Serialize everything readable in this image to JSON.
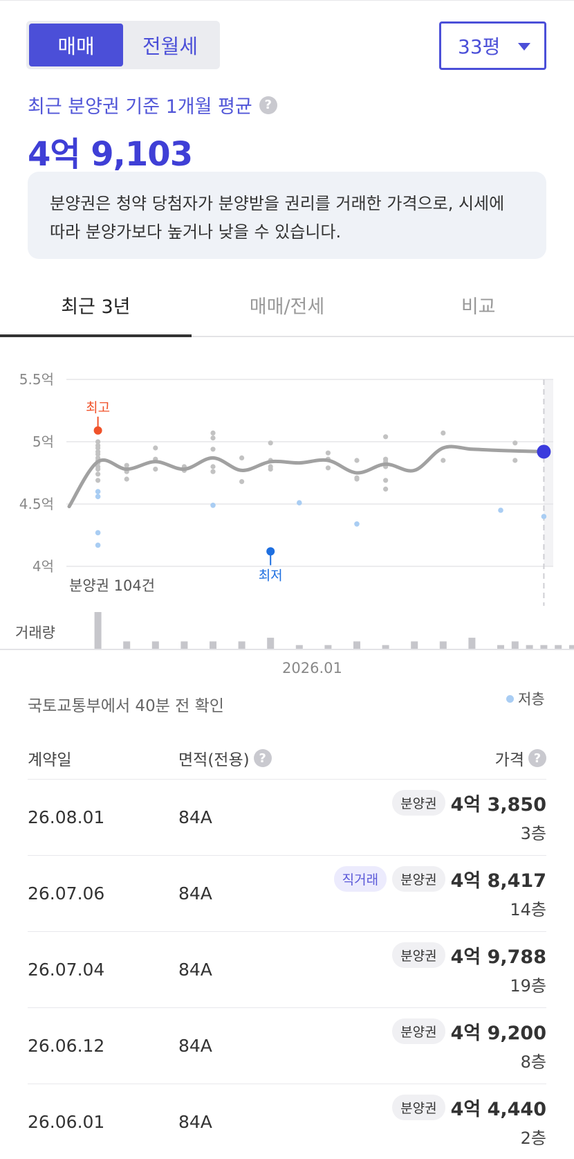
{
  "segmented": {
    "sale": "매매",
    "rent": "전월세"
  },
  "size_select": {
    "value": "33평"
  },
  "summary": {
    "label": "최근 분양권 기준 1개월 평균",
    "price": "4억 9,103"
  },
  "notice": "분양권은 청약 당첨자가 분양받을 권리를 거래한 가격으로, 시세에 따라 분양가보다 높거나 낮을 수 있습니다.",
  "tabs": [
    "최근 3년",
    "매매/전세",
    "비교"
  ],
  "chart": {
    "y_ticks": [
      "5.5억",
      "5억",
      "4.5억",
      "4억"
    ],
    "high_label": "최고",
    "low_label": "최저",
    "count_label": "분양권 104건",
    "volume_label": "거래량",
    "x_label": "2026.01",
    "colors": {
      "line": "#a1a1a1",
      "high": "#f0522a",
      "low": "#1e6fe0",
      "current": "#3b3bdd",
      "low_floor": "#a9cdf3",
      "normal": "#c2c2c2"
    }
  },
  "chart_data": {
    "type": "scatter",
    "ylim": [
      4.0,
      5.5
    ],
    "y_unit": "억",
    "trend_line": [
      [
        0,
        4.48
      ],
      [
        2,
        4.84
      ],
      [
        4,
        4.78
      ],
      [
        6,
        4.84
      ],
      [
        8,
        4.78
      ],
      [
        10,
        4.87
      ],
      [
        12,
        4.77
      ],
      [
        14,
        4.84
      ],
      [
        16,
        4.83
      ],
      [
        18,
        4.85
      ],
      [
        20,
        4.75
      ],
      [
        22,
        4.82
      ],
      [
        24,
        4.77
      ],
      [
        26,
        4.95
      ],
      [
        28,
        4.94
      ],
      [
        30,
        4.93
      ],
      [
        33,
        4.92
      ]
    ],
    "points": [
      [
        2,
        5.08
      ],
      [
        2,
        5.0
      ],
      [
        2,
        4.97
      ],
      [
        2,
        4.95
      ],
      [
        2,
        4.92
      ],
      [
        2,
        4.9
      ],
      [
        2,
        4.87
      ],
      [
        2,
        4.85
      ],
      [
        2,
        4.83
      ],
      [
        2,
        4.8
      ],
      [
        2,
        4.78
      ],
      [
        2,
        4.74
      ],
      [
        2,
        4.69
      ],
      [
        4,
        4.81
      ],
      [
        4,
        4.76
      ],
      [
        4,
        4.7
      ],
      [
        6,
        4.95
      ],
      [
        6,
        4.86
      ],
      [
        6,
        4.78
      ],
      [
        8,
        4.8
      ],
      [
        8,
        4.77
      ],
      [
        10,
        5.07
      ],
      [
        10,
        5.03
      ],
      [
        10,
        4.94
      ],
      [
        10,
        4.8
      ],
      [
        10,
        4.76
      ],
      [
        12,
        4.87
      ],
      [
        12,
        4.68
      ],
      [
        14,
        4.99
      ],
      [
        14,
        4.85
      ],
      [
        14,
        4.8
      ],
      [
        14,
        4.78
      ],
      [
        18,
        4.91
      ],
      [
        18,
        4.86
      ],
      [
        18,
        4.79
      ],
      [
        20,
        4.85
      ],
      [
        20,
        4.71
      ],
      [
        20,
        4.7
      ],
      [
        22,
        5.04
      ],
      [
        22,
        4.86
      ],
      [
        22,
        4.84
      ],
      [
        22,
        4.8
      ],
      [
        22,
        4.69
      ],
      [
        22,
        4.62
      ],
      [
        26,
        5.07
      ],
      [
        26,
        4.85
      ],
      [
        31,
        4.99
      ],
      [
        31,
        4.85
      ]
    ],
    "low_floor_points": [
      [
        2,
        4.6
      ],
      [
        2,
        4.56
      ],
      [
        2,
        4.27
      ],
      [
        2,
        4.17
      ],
      [
        10,
        4.49
      ],
      [
        16,
        4.51
      ],
      [
        20,
        4.34
      ],
      [
        30,
        4.45
      ],
      [
        33,
        4.4
      ]
    ],
    "high": [
      2,
      5.09
    ],
    "low": [
      14,
      4.12
    ],
    "current": [
      33,
      4.92
    ],
    "volume": [
      10,
      2,
      2,
      2,
      2,
      2,
      3,
      1,
      1,
      2,
      1,
      2,
      2,
      3,
      1,
      2,
      1,
      1,
      1,
      1
    ]
  },
  "source": "국토교통부에서 40분 전 확인",
  "legend": "저층",
  "table": {
    "headers": {
      "date": "계약일",
      "area": "면적(전용)",
      "price": "가격"
    },
    "rows": [
      {
        "date": "26.08.01",
        "area": "84A",
        "badges": [
          "분양권"
        ],
        "price": "4억 3,850",
        "floor": "3층"
      },
      {
        "date": "26.07.06",
        "area": "84A",
        "badges": [
          "직거래",
          "분양권"
        ],
        "price": "4억 8,417",
        "floor": "14층"
      },
      {
        "date": "26.07.04",
        "area": "84A",
        "badges": [
          "분양권"
        ],
        "price": "4억 9,788",
        "floor": "19층"
      },
      {
        "date": "26.06.12",
        "area": "84A",
        "badges": [
          "분양권"
        ],
        "price": "4억 9,200",
        "floor": "8층"
      },
      {
        "date": "26.06.01",
        "area": "84A",
        "badges": [
          "분양권"
        ],
        "price": "4억 4,440",
        "floor": "2층"
      }
    ]
  }
}
